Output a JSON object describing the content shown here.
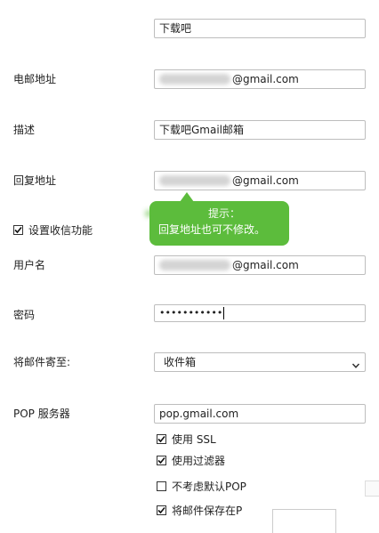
{
  "top_field": {
    "value": "下载吧"
  },
  "email_address": {
    "label": "电邮地址",
    "domain": "@gmail.com"
  },
  "description": {
    "label": "描述",
    "value": "下载吧Gmail邮箱"
  },
  "reply_address": {
    "label": "回复地址",
    "domain": "@gmail.com"
  },
  "tooltip": {
    "title": "提示：",
    "message": "回复地址也可不修改。"
  },
  "receive_settings": {
    "label": "设置收信功能"
  },
  "username": {
    "label": "用户名",
    "domain": "@gmail.com"
  },
  "password": {
    "label": "密码",
    "value": "•••••••••••"
  },
  "deliver_to": {
    "label": "将邮件寄至:",
    "selected": "收件箱"
  },
  "pop_server": {
    "label": "POP 服务器",
    "value": "pop.gmail.com"
  },
  "options": {
    "use_ssl": {
      "label": "使用 SSL",
      "checked": true
    },
    "use_filter": {
      "label": "使用过滤器",
      "checked": true
    },
    "ignore_default_pop": {
      "label": "不考虑默认POP",
      "checked": false
    },
    "save_mail": {
      "label": "将邮件保存在P",
      "checked": true
    }
  },
  "colors": {
    "tooltip_bg": "#5cbc3c",
    "border": "#bdbdbd"
  },
  "icons": {
    "checkbox_checked": "check-icon",
    "dropdown": "chevron-down-icon"
  }
}
